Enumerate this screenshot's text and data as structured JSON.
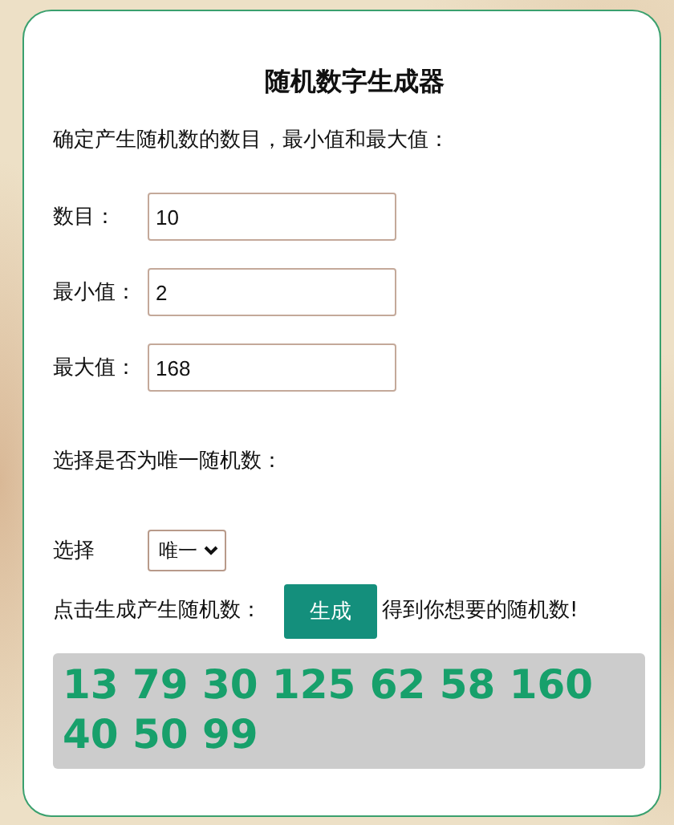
{
  "title": "随机数字生成器",
  "intro": "确定产生随机数的数目，最小值和最大值：",
  "fields": [
    {
      "label": "数目：",
      "value": "10"
    },
    {
      "label": "最小值：",
      "value": "2"
    },
    {
      "label": "最大值：",
      "value": "168"
    }
  ],
  "unique_prompt": "选择是否为唯一随机数：",
  "select": {
    "label": "选择",
    "value": "唯一"
  },
  "generate": {
    "before": "点击生成产生随机数：",
    "button": "生成",
    "after": "得到你想要的随机数!"
  },
  "result": "13 79 30 125 62 58 160 40 50 99"
}
